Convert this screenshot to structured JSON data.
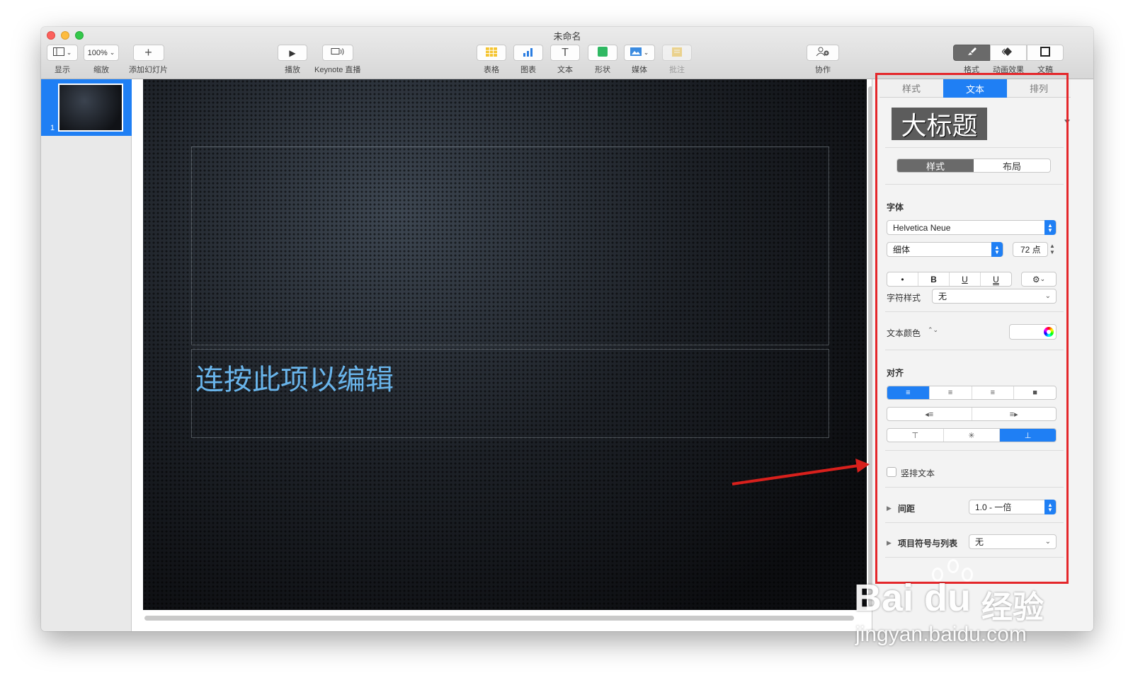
{
  "window": {
    "title": "未命名"
  },
  "toolbar": {
    "view_label": "显示",
    "zoom_value": "100%",
    "zoom_label": "缩放",
    "add_slide_label": "添加幻灯片",
    "play_label": "播放",
    "keynote_live_label": "Keynote 直播",
    "table_label": "表格",
    "chart_label": "图表",
    "text_label": "文本",
    "shape_label": "形状",
    "media_label": "媒体",
    "comment_label": "批注",
    "collaborate_label": "协作",
    "format_label": "格式",
    "animate_label": "动画效果",
    "document_label": "文稿"
  },
  "navigator": {
    "slide_number": "1"
  },
  "slide": {
    "body_placeholder": "连按此项以编辑"
  },
  "inspector": {
    "tabs": [
      "样式",
      "文本",
      "排列"
    ],
    "active_tab": "文本",
    "paragraph_style": "大标题",
    "subtabs": [
      "样式",
      "布局"
    ],
    "font_section": "字体",
    "font_family": "Helvetica Neue",
    "font_weight": "细体",
    "font_size": "72 点",
    "style_buttons": [
      "•",
      "B",
      "U",
      "U"
    ],
    "char_style_label": "字符样式",
    "char_style_value": "无",
    "text_color_label": "文本颜色",
    "alignment_label": "对齐",
    "vertical_text_label": "竖排文本",
    "spacing_label": "间距",
    "spacing_value": "1.0 - 一倍",
    "bullets_label": "项目符号与列表",
    "bullets_value": "无"
  },
  "watermark": {
    "logo": "Bai du",
    "site_name": "经验",
    "url": "jingyan.baidu.com"
  },
  "colors": {
    "accent": "#1f7ff4",
    "highlight": "#e4262a",
    "placeholder_text": "#69b4ea"
  }
}
